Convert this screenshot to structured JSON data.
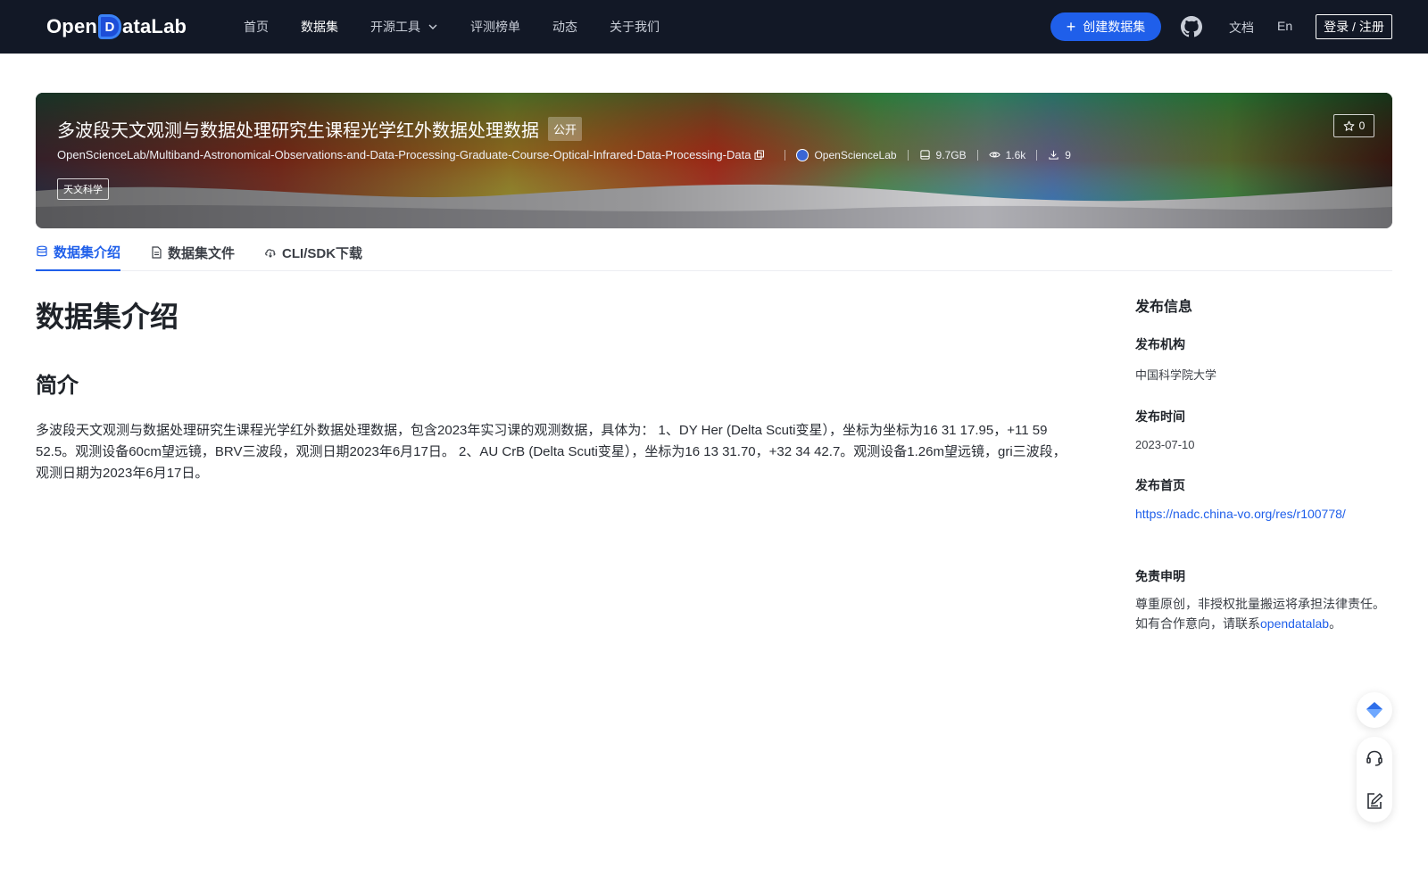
{
  "brand": {
    "logo_text_a": "Open",
    "logo_text_mark": "D",
    "logo_text_b": "ataLab"
  },
  "nav": {
    "items": [
      {
        "label": "首页",
        "active": false
      },
      {
        "label": "数据集",
        "active": true
      },
      {
        "label": "开源工具",
        "active": false
      },
      {
        "label": "评测榜单",
        "active": false
      },
      {
        "label": "动态",
        "active": false
      },
      {
        "label": "关于我们",
        "active": false
      }
    ],
    "create_label": "创建数据集",
    "docs_label": "文档",
    "lang_label": "En",
    "login_label": "登录 / 注册"
  },
  "dataset": {
    "title": "多波段天文观测与数据处理研究生课程光学红外数据处理数据",
    "visibility": "公开",
    "repo_id": "OpenScienceLab/Multiband-Astronomical-Observations-and-Data-Processing-Graduate-Course-Optical-Infrared-Data-Processing-Data",
    "org": "OpenScienceLab",
    "size": "9.7GB",
    "views": "1.6k",
    "downloads": "9",
    "tag": "天文科学",
    "stars": "0"
  },
  "tabs": [
    {
      "label": "数据集介绍",
      "icon": "database-icon",
      "active": true
    },
    {
      "label": "数据集文件",
      "icon": "file-icon",
      "active": false
    },
    {
      "label": "CLI/SDK下载",
      "icon": "cloud-download-icon",
      "active": false
    }
  ],
  "content": {
    "heading": "数据集介绍",
    "subheading": "简介",
    "paragraph": "多波段天文观测与数据处理研究生课程光学红外数据处理数据，包含2023年实习课的观测数据，具体为： 1、DY Her (Delta Scuti变星），坐标为坐标为16 31 17.95，+11 59 52.5。观测设备60cm望远镜，BRV三波段，观测日期2023年6月17日。 2、AU CrB (Delta Scuti变星），坐标为16 13 31.70，+32 34 42.7。观测设备1.26m望远镜，gri三波段，观测日期为2023年6月17日。"
  },
  "publish": {
    "heading": "发布信息",
    "org_label": "发布机构",
    "org_value": "中国科学院大学",
    "time_label": "发布时间",
    "time_value": "2023-07-10",
    "home_label": "发布首页",
    "home_url": "https://nadc.china-vo.org/res/r100778/",
    "disclaimer_label": "免责申明",
    "disclaimer_line1": "尊重原创，非授权批量搬运将承担法律责任。",
    "disclaimer_line2_prefix": "如有合作意向，请联系",
    "disclaimer_link": "opendatalab",
    "disclaimer_line2_suffix": "。"
  },
  "colors": {
    "nav_bg": "#121826",
    "accent": "#1f5fea"
  }
}
